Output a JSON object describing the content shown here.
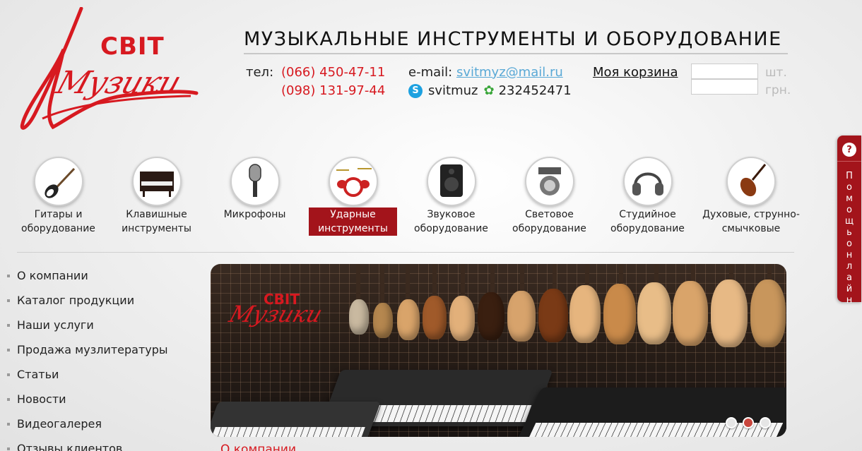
{
  "logo": {
    "svit": "СВІТ",
    "muzyky": "Музики"
  },
  "header": {
    "title": "МУЗЫКАЛЬНЫЕ ИНСТРУМЕНТЫ И ОБОРУДОВАНИЕ",
    "tel_label": "тел:",
    "phones": [
      "(066) 450-47-11",
      "(098) 131-97-44"
    ],
    "email_label": "e-mail:",
    "email": "svitmyz@mail.ru",
    "skype": "svitmuz",
    "icq": "232452471"
  },
  "cart": {
    "label": "Моя корзина",
    "unit_qty": "шт.",
    "unit_sum": "грн."
  },
  "categories": [
    {
      "label": "Гитары и оборудование",
      "icon": "guitar-icon"
    },
    {
      "label": "Клавишные инструменты",
      "icon": "piano-icon"
    },
    {
      "label": "Микрофоны",
      "icon": "microphone-icon"
    },
    {
      "label": "Ударные инструменты",
      "icon": "drums-icon",
      "active": true
    },
    {
      "label": "Звуковое оборудование",
      "icon": "speaker-icon"
    },
    {
      "label": "Световое оборудование",
      "icon": "light-icon"
    },
    {
      "label": "Студийное оборудование",
      "icon": "headphones-icon"
    },
    {
      "label": "Духовые, струнно-смычковые",
      "icon": "violin-icon"
    }
  ],
  "sidebar": {
    "items": [
      "О компании",
      "Каталог продукции",
      "Наши услуги",
      "Продажа музлитературы",
      "Статьи",
      "Новости",
      "Видеогалерея",
      "Отзывы клиентов"
    ]
  },
  "banner": {
    "logo_svit": "СВІТ",
    "logo_muzyky": "Музики",
    "slides": 3,
    "active_slide": 2
  },
  "bottom": {
    "link": "О компании"
  },
  "help": {
    "text": "Помощь онлайн"
  },
  "colors": {
    "brand_red": "#d71920",
    "active_red": "#a3141b",
    "link_blue": "#5aa9d6"
  }
}
